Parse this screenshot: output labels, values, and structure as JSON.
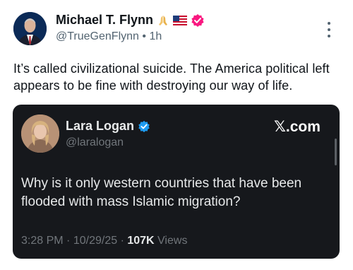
{
  "post": {
    "author_name": "Michael T. Flynn",
    "handle": "@TrueGenFlynn",
    "separator": "•",
    "time": "1h",
    "text": "It’s called civilizational suicide. The America political left appears to be fine with destroying our way of life."
  },
  "quote": {
    "author_name": "Lara Logan",
    "handle": "@laralogan",
    "brand": "𝕏.com",
    "text": "Why is it only western countries that have been flooded with mass Islamic migration?",
    "time": "3:28 PM",
    "dot1": "·",
    "date": "10/29/25",
    "dot2": "·",
    "views_count": "107K",
    "views_label": "Views"
  },
  "colors": {
    "verified_badge": "#f91880",
    "verified_blue": "#1d9bf0",
    "card_bg": "#16181c"
  },
  "icons": [
    "praying-hands-icon",
    "us-flag-icon",
    "verified-badge-icon",
    "more-options-icon",
    "verified-checkmark-icon"
  ]
}
